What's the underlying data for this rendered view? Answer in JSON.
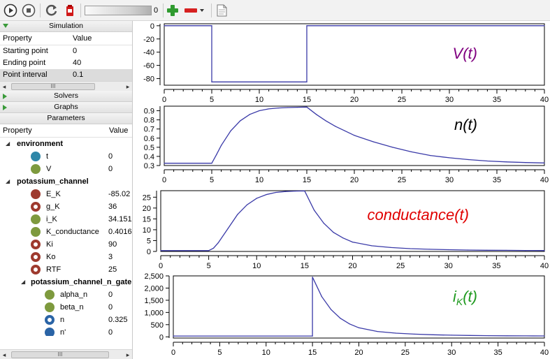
{
  "toolbar": {
    "slider_value": "0",
    "buttons": [
      "run-icon",
      "stop-icon",
      "reset-icon",
      "clear-icon",
      "add-graph-icon",
      "remove-graph-icon",
      "csv-export-icon"
    ]
  },
  "simulation": {
    "title": "Simulation",
    "col_property": "Property",
    "col_value": "Value",
    "rows": [
      {
        "property": "Starting point",
        "value": "0"
      },
      {
        "property": "Ending point",
        "value": "40"
      },
      {
        "property": "Point interval",
        "value": "0.1"
      }
    ],
    "scroll_grip": "III"
  },
  "solvers": {
    "title": "Solvers"
  },
  "graphs": {
    "title": "Graphs"
  },
  "parameters": {
    "title": "Parameters",
    "col_property": "Property",
    "col_value": "Value",
    "groups": [
      {
        "name": "environment",
        "items": [
          {
            "name": "t",
            "value": "0"
          },
          {
            "name": "V",
            "value": "0"
          }
        ]
      },
      {
        "name": "potassium_channel",
        "items": [
          {
            "name": "E_K",
            "value": "-85.02"
          },
          {
            "name": "g_K",
            "value": "36"
          },
          {
            "name": "i_K",
            "value": "34.151"
          },
          {
            "name": "K_conductance",
            "value": "0.4016"
          },
          {
            "name": "Ki",
            "value": "90"
          },
          {
            "name": "Ko",
            "value": "3"
          },
          {
            "name": "RTF",
            "value": "25"
          }
        ]
      },
      {
        "name": "potassium_channel_n_gate",
        "items": [
          {
            "name": "alpha_n",
            "value": "0"
          },
          {
            "name": "beta_n",
            "value": "0"
          },
          {
            "name": "n",
            "value": "0.325"
          },
          {
            "name": "n'",
            "value": "0"
          }
        ]
      }
    ],
    "scroll_grip": "III"
  },
  "colors": {
    "dark_red": "#9e3a2e",
    "green": "#7e9a3e",
    "teal": "#2f87a8",
    "blue": "#2a64a6",
    "trace": "#3a3aa8",
    "label_V": "#800080",
    "label_cond": "#e00000",
    "label_iK": "#1f9a1f"
  },
  "chart_data": [
    {
      "type": "line",
      "label": "V(t)",
      "xlim": [
        0,
        40
      ],
      "ylim": [
        -90,
        3
      ],
      "xticks": [
        0,
        5,
        10,
        15,
        20,
        25,
        30,
        35,
        40
      ],
      "yticks": [
        "0",
        "-20",
        "-40",
        "-60",
        "-80"
      ],
      "ytick_values": [
        0,
        -20,
        -40,
        -60,
        -80
      ],
      "x": [
        0,
        5,
        5,
        15,
        15,
        40
      ],
      "y": [
        0,
        0,
        -85,
        -85,
        0,
        0
      ]
    },
    {
      "type": "line",
      "label": "n(t)",
      "xlim": [
        0,
        40
      ],
      "ylim": [
        0.3,
        0.95
      ],
      "xticks": [
        0,
        5,
        10,
        15,
        20,
        25,
        30,
        35,
        40
      ],
      "yticks": [
        "0.9",
        "0.8",
        "0.7",
        "0.6",
        "0.5",
        "0.4",
        "0.3"
      ],
      "ytick_values": [
        0.9,
        0.8,
        0.7,
        0.6,
        0.5,
        0.4,
        0.3
      ],
      "x": [
        0,
        5,
        5.5,
        6,
        7,
        8,
        9,
        10,
        11,
        12,
        13,
        14,
        15,
        16,
        17,
        18,
        19,
        20,
        22,
        24,
        26,
        28,
        30,
        32,
        34,
        36,
        38,
        40
      ],
      "y": [
        0.325,
        0.325,
        0.42,
        0.52,
        0.68,
        0.79,
        0.86,
        0.9,
        0.92,
        0.93,
        0.935,
        0.938,
        0.94,
        0.86,
        0.79,
        0.73,
        0.68,
        0.63,
        0.56,
        0.5,
        0.45,
        0.41,
        0.385,
        0.365,
        0.35,
        0.34,
        0.333,
        0.328
      ]
    },
    {
      "type": "line",
      "label": "conductance(t)",
      "xlim": [
        0,
        40
      ],
      "ylim": [
        0,
        28
      ],
      "xticks": [
        0,
        5,
        10,
        15,
        20,
        25,
        30,
        35,
        40
      ],
      "yticks": [
        "25",
        "20",
        "15",
        "10",
        "5",
        "0"
      ],
      "ytick_values": [
        25,
        20,
        15,
        10,
        5,
        0
      ],
      "x": [
        0,
        5,
        5.5,
        6,
        7,
        8,
        9,
        10,
        11,
        12,
        13,
        14,
        15,
        16,
        17,
        18,
        19,
        20,
        22,
        24,
        26,
        28,
        30,
        32,
        34,
        36,
        38,
        40
      ],
      "y": [
        0.4,
        0.4,
        1.5,
        4,
        10.5,
        17,
        21.5,
        24.5,
        26.2,
        27.2,
        27.6,
        27.8,
        27.9,
        19,
        13,
        8.8,
        6.2,
        4.3,
        2.6,
        1.8,
        1.3,
        1.0,
        0.8,
        0.65,
        0.55,
        0.5,
        0.45,
        0.42
      ]
    },
    {
      "type": "line",
      "label": "i_K(t)",
      "xlim": [
        0,
        40
      ],
      "ylim": [
        -50,
        2500
      ],
      "xticks": [
        0,
        5,
        10,
        15,
        20,
        25,
        30,
        35,
        40
      ],
      "yticks": [
        "2,500",
        "2,000",
        "1,500",
        "1,000",
        "500",
        "0"
      ],
      "ytick_values": [
        2500,
        2000,
        1500,
        1000,
        500,
        0
      ],
      "x": [
        0,
        15,
        15,
        16,
        17,
        18,
        19,
        20,
        22,
        24,
        26,
        28,
        30,
        32,
        34,
        36,
        38,
        40
      ],
      "y": [
        34,
        34,
        2450,
        1650,
        1120,
        760,
        530,
        370,
        220,
        150,
        110,
        85,
        68,
        56,
        48,
        42,
        38,
        35
      ]
    }
  ]
}
